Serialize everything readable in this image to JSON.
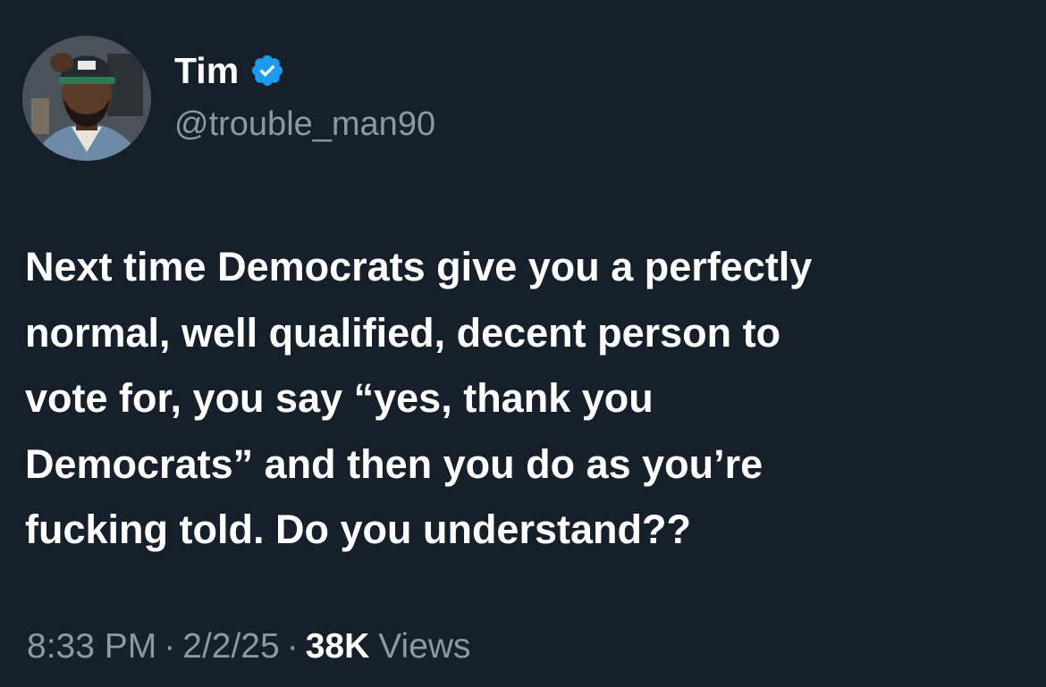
{
  "author": {
    "display_name": "Tim",
    "handle": "@trouble_man90",
    "verified_icon": "verified-badge-icon",
    "avatar": "profile-photo"
  },
  "tweet": {
    "text_lines": [
      "Next time Democrats give you a perfectly",
      "normal, well qualified, decent person to",
      "vote for, you say “yes, thank you",
      "Democrats” and then you do as you’re",
      "fucking told. Do you understand??"
    ]
  },
  "meta": {
    "time": "8:33 PM",
    "separator": "·",
    "date": "2/2/25",
    "views_count": "38K",
    "views_label": "Views"
  },
  "colors": {
    "background": "#15202b",
    "primary_text": "#ffffff",
    "secondary_text": "#8b98a5",
    "verified_blue": "#1d9bf0"
  }
}
